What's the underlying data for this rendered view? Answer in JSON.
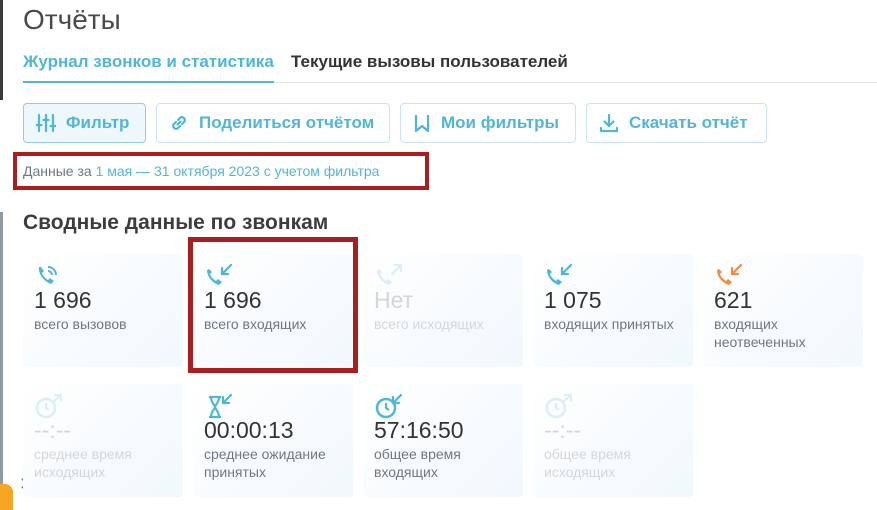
{
  "page": {
    "title": "Отчёты"
  },
  "tabs": [
    {
      "label": "Журнал звонков и статистика",
      "active": true
    },
    {
      "label": "Текущие вызовы пользователей",
      "active": false
    }
  ],
  "toolbar": {
    "filter_label": "Фильтр",
    "share_label": "Поделиться отчётом",
    "my_filters_label": "Мои фильтры",
    "download_label": "Скачать отчёт"
  },
  "period": {
    "prefix": "Данные за",
    "range": "1 мая — 31 октября 2023 с учетом фильтра"
  },
  "summary": {
    "title": "Сводные данные по звонкам",
    "cards": [
      {
        "value": "1 696",
        "label": "всего вызовов",
        "icon": "phone-calls-icon"
      },
      {
        "value": "1 696",
        "label": "всего входящих",
        "icon": "incoming-call-icon"
      },
      {
        "value": "Нет",
        "label": "всего исходящих",
        "icon": "outgoing-call-icon"
      },
      {
        "value": "1 075",
        "label": "входящих принятых",
        "icon": "incoming-accepted-icon"
      },
      {
        "value": "621",
        "label": "входящих неотвеченных",
        "icon": "incoming-missed-icon"
      },
      {
        "value": "--:--",
        "label": "среднее время исходящих",
        "icon": "clock-outgoing-icon"
      },
      {
        "value": "00:00:13",
        "label": "среднее ожидание принятых",
        "icon": "hourglass-incoming-icon"
      },
      {
        "value": "57:16:50",
        "label": "общее время входящих",
        "icon": "clock-incoming-icon"
      },
      {
        "value": "--:--",
        "label": "общее время исходящих",
        "icon": "clock-outgoing-icon"
      }
    ]
  },
  "close_label": "✕",
  "colors": {
    "accent": "#4fb6da",
    "highlight": "#a91f1f",
    "missed": "#f08a4b",
    "dim": "#d2d7dc"
  }
}
